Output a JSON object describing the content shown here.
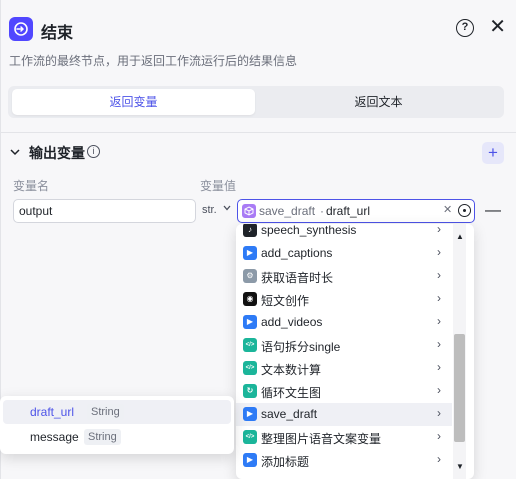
{
  "header": {
    "title": "结束",
    "help_glyph": "?",
    "close_glyph": "✕",
    "description": "工作流的最终节点，用于返回工作流运行后的结果信息"
  },
  "tabs": [
    {
      "label": "返回变量",
      "active": true
    },
    {
      "label": "返回文本",
      "active": false
    }
  ],
  "output_section": {
    "title": "输出变量",
    "info_glyph": "i",
    "add_glyph": "+",
    "columns": {
      "name": "变量名",
      "value": "变量值"
    },
    "row": {
      "name": "output",
      "type": "str.",
      "type_chevron": "⌄",
      "value_source": "save_draft",
      "value_separator": "·",
      "value_field": "draft_url",
      "clear_glyph": "✕",
      "remove_glyph": "—"
    }
  },
  "node_dropdown": {
    "items": [
      {
        "label": "speech_synthesis",
        "icon": "speech-icon",
        "color": "#1f2329"
      },
      {
        "label": "add_captions",
        "icon": "play-icon",
        "color": "#2e7bf6"
      },
      {
        "label": "获取语音时长",
        "icon": "gear-icon",
        "color": "#8c9aa8"
      },
      {
        "label": "短文创作",
        "icon": "ghost-icon",
        "color": "#111111"
      },
      {
        "label": "add_videos",
        "icon": "play-icon",
        "color": "#2e7bf6"
      },
      {
        "label": "语句拆分single",
        "icon": "code-icon",
        "color": "#1bb59a"
      },
      {
        "label": "文本数计算",
        "icon": "code-icon",
        "color": "#1bb59a"
      },
      {
        "label": "循环文生图",
        "icon": "loop-icon",
        "color": "#1bb59a"
      },
      {
        "label": "save_draft",
        "icon": "play-icon",
        "color": "#2e7bf6",
        "highlighted": true
      },
      {
        "label": "整理图片语音文案变量",
        "icon": "code-icon",
        "color": "#1bb59a"
      },
      {
        "label": "添加标题",
        "icon": "play-icon",
        "color": "#2e7bf6"
      }
    ],
    "chevron": "›",
    "scroll_up": "▲",
    "scroll_down": "▼"
  },
  "field_popover": {
    "items": [
      {
        "name": "draft_url",
        "type": "String",
        "selected": true
      },
      {
        "name": "message",
        "type": "String",
        "selected": false
      }
    ]
  },
  "colors": {
    "accent": "#4d53e8",
    "node_icon": "#5147ff",
    "variable_cube": "#a97bf5"
  }
}
